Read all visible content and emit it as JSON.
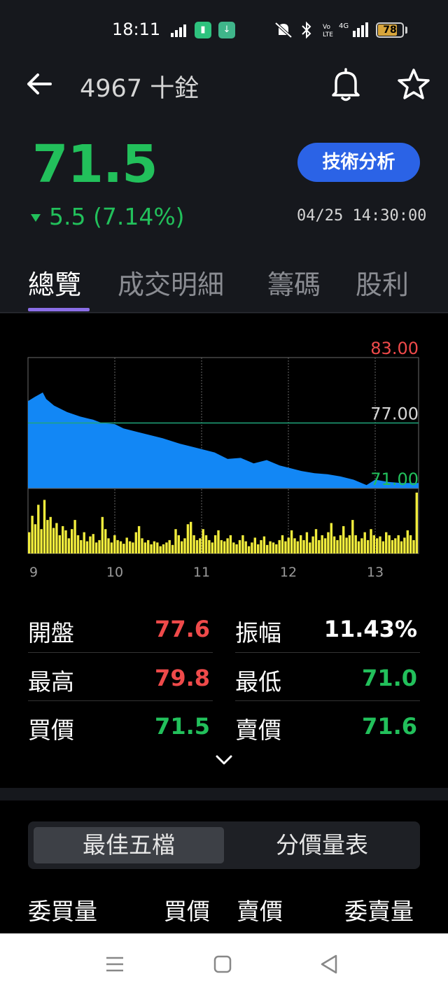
{
  "status_bar": {
    "time": "18:11",
    "battery": "78",
    "battery_level": 0.78,
    "network": "4G"
  },
  "header": {
    "stock_title": "4967 十銓",
    "price": "71.5",
    "change": "5.5 (7.14%)",
    "timestamp": "04/25 14:30:00",
    "tech_analysis_label": "技術分析"
  },
  "tabs": [
    {
      "label": "總覽",
      "active": true
    },
    {
      "label": "成交明細",
      "active": false
    },
    {
      "label": "籌碼",
      "active": false
    },
    {
      "label": "股利",
      "active": false
    }
  ],
  "chart_data": {
    "type": "area",
    "y_labels": [
      "83.00",
      "77.00",
      "71.00"
    ],
    "ylim": [
      71,
      83
    ],
    "reference_line": 77,
    "x_tick_labels": [
      "9",
      "10",
      "11",
      "12",
      "13"
    ],
    "xlim": [
      9,
      13.5
    ],
    "price_series": [
      [
        9.0,
        79.0
      ],
      [
        9.08,
        79.4
      ],
      [
        9.17,
        79.8
      ],
      [
        9.21,
        79.2
      ],
      [
        9.3,
        78.6
      ],
      [
        9.45,
        78.0
      ],
      [
        9.6,
        77.6
      ],
      [
        9.75,
        77.3
      ],
      [
        9.85,
        77.0
      ],
      [
        10.0,
        76.9
      ],
      [
        10.1,
        76.5
      ],
      [
        10.25,
        76.2
      ],
      [
        10.4,
        75.9
      ],
      [
        10.55,
        75.6
      ],
      [
        10.75,
        75.1
      ],
      [
        10.9,
        74.8
      ],
      [
        11.0,
        74.6
      ],
      [
        11.15,
        74.3
      ],
      [
        11.3,
        73.7
      ],
      [
        11.45,
        73.8
      ],
      [
        11.6,
        73.3
      ],
      [
        11.75,
        73.6
      ],
      [
        11.9,
        73.1
      ],
      [
        12.0,
        72.9
      ],
      [
        12.15,
        72.6
      ],
      [
        12.3,
        72.4
      ],
      [
        12.45,
        72.3
      ],
      [
        12.6,
        72.1
      ],
      [
        12.75,
        71.8
      ],
      [
        12.9,
        71.3
      ],
      [
        13.0,
        71.8
      ],
      [
        13.15,
        71.6
      ],
      [
        13.3,
        71.5
      ],
      [
        13.5,
        71.5
      ]
    ],
    "volume_series": [
      0.35,
      0.62,
      0.48,
      0.8,
      0.4,
      0.88,
      0.55,
      0.6,
      0.42,
      0.5,
      0.3,
      0.45,
      0.38,
      0.25,
      0.4,
      0.55,
      0.3,
      0.22,
      0.35,
      0.2,
      0.28,
      0.32,
      0.18,
      0.22,
      0.6,
      0.4,
      0.25,
      0.18,
      0.3,
      0.22,
      0.2,
      0.16,
      0.26,
      0.2,
      0.18,
      0.35,
      0.45,
      0.25,
      0.18,
      0.22,
      0.15,
      0.2,
      0.18,
      0.12,
      0.15,
      0.18,
      0.22,
      0.14,
      0.4,
      0.3,
      0.2,
      0.25,
      0.48,
      0.52,
      0.3,
      0.22,
      0.25,
      0.4,
      0.3,
      0.22,
      0.18,
      0.3,
      0.38,
      0.22,
      0.2,
      0.25,
      0.3,
      0.18,
      0.15,
      0.22,
      0.3,
      0.2,
      0.12,
      0.18,
      0.26,
      0.15,
      0.22,
      0.28,
      0.14,
      0.2,
      0.18,
      0.15,
      0.22,
      0.3,
      0.2,
      0.26,
      0.38,
      0.25,
      0.2,
      0.3,
      0.22,
      0.35,
      0.18,
      0.28,
      0.4,
      0.22,
      0.3,
      0.25,
      0.35,
      0.5,
      0.28,
      0.22,
      0.3,
      0.45,
      0.26,
      0.3,
      0.55,
      0.3,
      0.2,
      0.25,
      0.35,
      0.22,
      0.4,
      0.3,
      0.25,
      0.28,
      0.2,
      0.35,
      0.3,
      0.22,
      0.25,
      0.3,
      0.2,
      0.26,
      0.38,
      0.3,
      0.22,
      1.0
    ]
  },
  "quote": {
    "open_label": "開盤",
    "open_value": "77.6",
    "amplitude_label": "振幅",
    "amplitude_value": "11.43%",
    "high_label": "最高",
    "high_value": "79.8",
    "low_label": "最低",
    "low_value": "71.0",
    "bid_label": "買價",
    "bid_value": "71.5",
    "ask_label": "賣價",
    "ask_value": "71.6"
  },
  "order_book": {
    "segments": [
      "最佳五檔",
      "分價量表"
    ],
    "headers": [
      "委買量",
      "買價",
      "賣價",
      "委賣量"
    ]
  },
  "colors": {
    "up": "#ef4a4a",
    "down": "#22c05b",
    "accent": "#2b63e6",
    "area": "#1287f5",
    "volume": "#f1ec3c"
  }
}
